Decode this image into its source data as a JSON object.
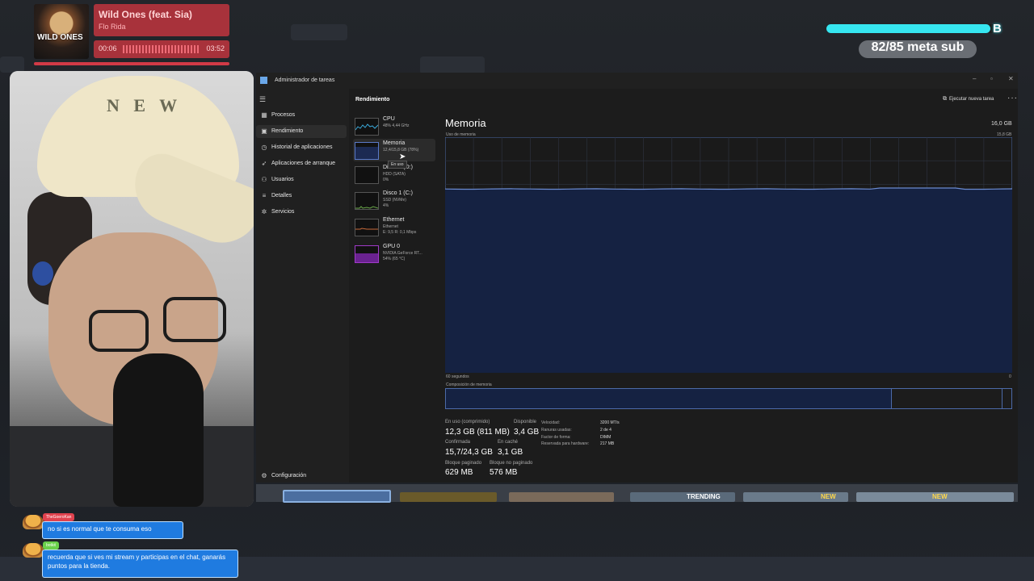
{
  "music": {
    "title": "Wild Ones (feat. Sia)",
    "artist": "Flo Rida",
    "album_text": "WILD ONES",
    "current_time": "00:06",
    "total_time": "03:52"
  },
  "sub_goal": {
    "label": "82/85 meta sub",
    "progress": 0.9647
  },
  "task_manager": {
    "window_title": "Administrador de tareas",
    "page_title": "Rendimiento",
    "run_task_label": "Ejecutar nueva tarea",
    "nav": [
      {
        "label": "Procesos",
        "icon": "grid-icon"
      },
      {
        "label": "Rendimiento",
        "icon": "chart-icon",
        "active": true
      },
      {
        "label": "Historial de aplicaciones",
        "icon": "history-icon"
      },
      {
        "label": "Aplicaciones de arranque",
        "icon": "rocket-icon"
      },
      {
        "label": "Usuarios",
        "icon": "users-icon"
      },
      {
        "label": "Detalles",
        "icon": "list-icon"
      },
      {
        "label": "Servicios",
        "icon": "puzzle-icon"
      }
    ],
    "settings_label": "Configuración",
    "resources": [
      {
        "name": "CPU",
        "sub1": "48% 4,44 GHz",
        "sub2": "",
        "color": "#3aa8d8"
      },
      {
        "name": "Memoria",
        "sub1": "12,4/15,8 GB (78%)",
        "sub2": "",
        "color": "#5a7ac8",
        "active": true
      },
      {
        "name": "Disco 0 (D:)",
        "sub1": "HDD (SATA)",
        "sub2": "0%",
        "color": "#6aa84a"
      },
      {
        "name": "Disco 1 (C:)",
        "sub1": "SSD (NVMe)",
        "sub2": "4%",
        "color": "#6aa84a"
      },
      {
        "name": "Ethernet",
        "sub1": "Ethernet",
        "sub2": "E: 9,5 R: 0,1 Mbps",
        "color": "#c86a3a"
      },
      {
        "name": "GPU 0",
        "sub1": "NVIDIA GeForce RT...",
        "sub2": "54% (65 °C)",
        "color": "#a03ac8"
      }
    ],
    "tooltip": "En uso",
    "memory": {
      "title": "Memoria",
      "total": "16,0 GB",
      "graph_label": "Uso de memoria",
      "graph_max": "15,8 GB",
      "graph_x_left": "60 segundos",
      "graph_x_right": "0",
      "composition_label": "Composición de memoria",
      "usage_fraction": 0.78,
      "composition": {
        "in_use": 0.787,
        "cached": 0.196
      },
      "stats": {
        "in_use_label": "En uso (comprimido)",
        "in_use_value": "12,3 GB (811 MB)",
        "available_label": "Disponible",
        "available_value": "3,4 GB",
        "committed_label": "Confirmada",
        "committed_value": "15,7/24,3 GB",
        "cached_label": "En caché",
        "cached_value": "3,1 GB",
        "paged_label": "Bloque paginado",
        "paged_value": "629 MB",
        "nonpaged_label": "Bloque no paginado",
        "nonpaged_value": "576 MB"
      },
      "specs": {
        "speed_label": "Velocidad:",
        "speed_value": "3200 MT/s",
        "slots_label": "Ranuras usadas:",
        "slots_value": "2 de 4",
        "form_label": "Factor de forma:",
        "form_value": "DIMM",
        "reserved_label": "Reservada para hardware:",
        "reserved_value": "217 MB"
      }
    }
  },
  "strip_labels": [
    "TRENDING",
    "NEW",
    "NEW"
  ],
  "chat": [
    {
      "user": "TheGoeroKan",
      "text": "no si es normal que te consuma eso",
      "name_color": "red"
    },
    {
      "user": "botkit",
      "text": "recuerda que si ves mi stream y participas en el chat, ganarás puntos para la tienda.",
      "name_color": "green"
    }
  ]
}
